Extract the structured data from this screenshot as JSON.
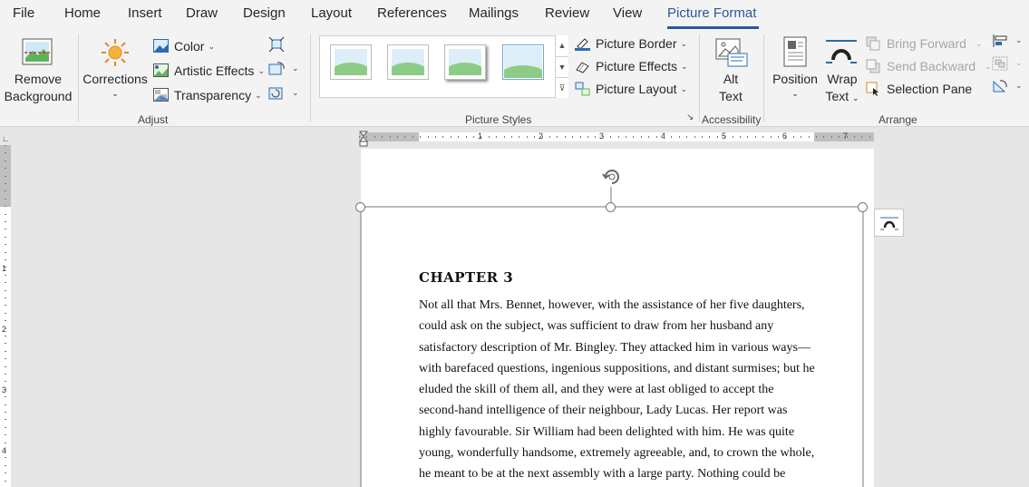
{
  "tabs": [
    "File",
    "Home",
    "Insert",
    "Draw",
    "Design",
    "Layout",
    "References",
    "Mailings",
    "Review",
    "View",
    "Picture Format"
  ],
  "active_tab": "Picture Format",
  "colors": {
    "accent": "#2b579a",
    "ribbon_bg": "#f3f3f3",
    "workspace_bg": "#e6e6e6",
    "disabled_text": "#a6a6a6"
  },
  "adjust": {
    "remove_background": [
      "Remove",
      "Background"
    ],
    "corrections": "Corrections",
    "color": "Color",
    "artistic_effects": "Artistic Effects",
    "transparency": "Transparency",
    "group_label": "Adjust"
  },
  "picture_styles": {
    "picture_border": "Picture Border",
    "picture_effects": "Picture Effects",
    "picture_layout": "Picture Layout",
    "group_label": "Picture Styles"
  },
  "accessibility": {
    "alt_text": [
      "Alt",
      "Text"
    ],
    "group_label": "Accessibility"
  },
  "arrange": {
    "position": "Position",
    "wrap_text": [
      "Wrap",
      "Text"
    ],
    "bring_forward": "Bring Forward",
    "send_backward": "Send Backward",
    "selection_pane": "Selection Pane",
    "group_label": "Arrange"
  },
  "ruler": {
    "h_numbers": [
      "1",
      "2",
      "3",
      "4",
      "5",
      "6",
      "7"
    ],
    "v_numbers": [
      "1",
      "2",
      "3",
      "4"
    ]
  },
  "document": {
    "chapter_title": "CHAPTER 3",
    "lines": [
      "Not all that Mrs. Bennet, however, with the assistance of her five daughters,",
      "could ask on the subject, was sufficient to draw from her husband any",
      "satisfactory description of Mr. Bingley. They attacked him in various ways—",
      "with barefaced questions, ingenious suppositions, and distant surmises; but he",
      "eluded the skill of them all, and they were at last obliged to accept the",
      "second-hand intelligence of their neighbour, Lady Lucas. Her report was",
      "highly favourable. Sir William had been delighted with him. He was quite",
      "young, wonderfully handsome, extremely agreeable, and, to crown the whole,",
      "he meant to be at the next assembly with a large party. Nothing could be"
    ]
  }
}
